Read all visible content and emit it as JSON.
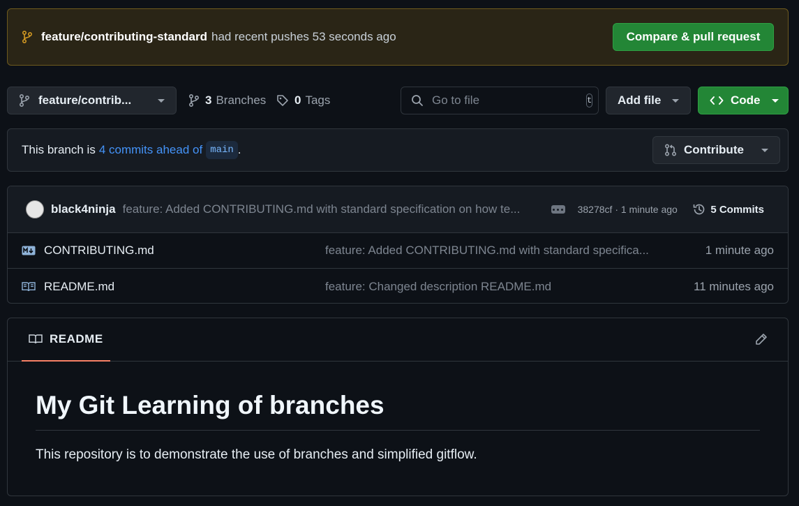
{
  "banner": {
    "branch": "feature/contributing-standard",
    "text": "had recent pushes 53 seconds ago",
    "compare_label": "Compare & pull request"
  },
  "toolbar": {
    "branch_select_label": "feature/contrib...",
    "branches_count": "3",
    "branches_label": "Branches",
    "tags_count": "0",
    "tags_label": "Tags",
    "search_placeholder": "Go to file",
    "search_shortcut": "t",
    "add_file_label": "Add file",
    "code_label": "Code"
  },
  "ahead": {
    "prefix": "This branch is",
    "link": "4 commits ahead of",
    "base": "main",
    "suffix": ".",
    "contribute_label": "Contribute"
  },
  "latest_commit": {
    "author": "black4ninja",
    "message": "feature: Added CONTRIBUTING.md with standard specification on how te...",
    "sha_time": "38278cf · 1 minute ago",
    "commits_label": "5 Commits"
  },
  "files": [
    {
      "name": "CONTRIBUTING.md",
      "icon": "markdown-icon",
      "message": "feature: Added CONTRIBUTING.md with standard specifica...",
      "time": "1 minute ago"
    },
    {
      "name": "README.md",
      "icon": "book-file-icon",
      "message": "feature: Changed description README.md",
      "time": "11 minutes ago"
    }
  ],
  "readme": {
    "tab_label": "README",
    "heading": "My Git Learning of branches",
    "body": "This repository is to demonstrate the use of branches and simplified gitflow."
  },
  "colors": {
    "background": "#0d1117",
    "green": "#238636",
    "link": "#4493f8",
    "banner_bg": "#2a2516",
    "tab_underline": "#f78166"
  }
}
